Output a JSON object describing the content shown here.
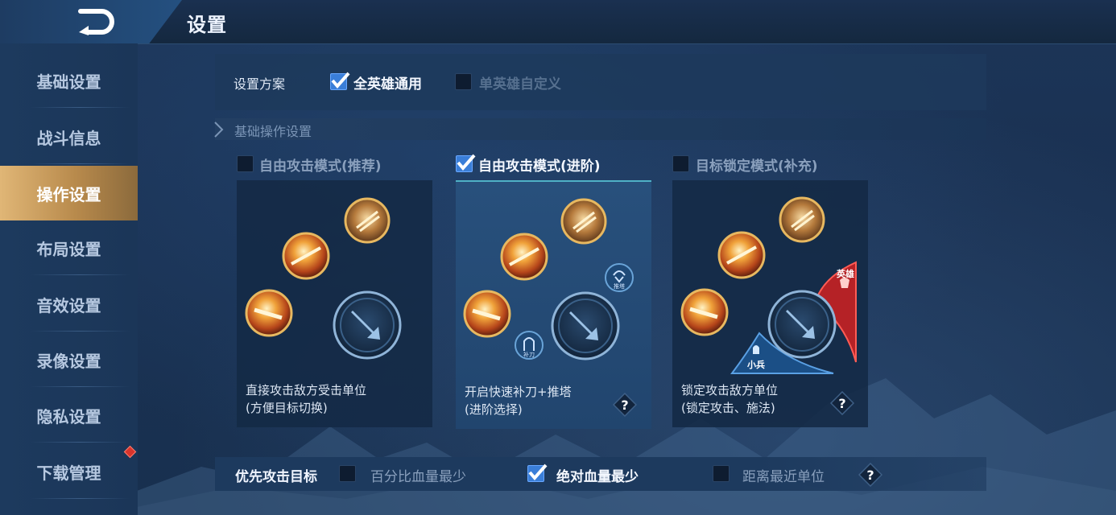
{
  "header": {
    "title": "设置"
  },
  "sidebar": {
    "items": [
      {
        "label": "基础设置"
      },
      {
        "label": "战斗信息"
      },
      {
        "label": "操作设置"
      },
      {
        "label": "布局设置"
      },
      {
        "label": "音效设置"
      },
      {
        "label": "录像设置"
      },
      {
        "label": "隐私设置"
      },
      {
        "label": "下载管理"
      }
    ],
    "active_index": 2
  },
  "scheme": {
    "label": "设置方案",
    "options": [
      {
        "label": "全英雄通用",
        "checked": true
      },
      {
        "label": "单英雄自定义",
        "checked": false
      }
    ]
  },
  "section": {
    "title": "基础操作设置"
  },
  "modes": [
    {
      "label": "自由攻击模式(推荐)",
      "checked": false,
      "desc1": "直接攻击敌方受击单位",
      "desc2": "(方便目标切换)",
      "has_help": false
    },
    {
      "label": "自由攻击模式(进阶)",
      "checked": true,
      "desc1": "开启快速补刀+推塔",
      "desc2": "(进阶选择)",
      "has_help": true,
      "badge_top": "推塔",
      "badge_bottom": "补刀"
    },
    {
      "label": "目标锁定模式(补充)",
      "checked": false,
      "desc1": "锁定攻击敌方单位",
      "desc2": "(锁定攻击、施法)",
      "has_help": true,
      "hero_tab": "英雄",
      "minion_tab": "小兵"
    }
  ],
  "priority": {
    "label": "优先攻击目标",
    "options": [
      {
        "label": "百分比血量最少",
        "checked": false
      },
      {
        "label": "绝对血量最少",
        "checked": true
      },
      {
        "label": "距离最近单位",
        "checked": false
      }
    ]
  },
  "help_glyph": "?",
  "colors": {
    "accent_gold": "#d9ae6e",
    "check_blue": "#3a7ed8",
    "card_selected": "#24497a",
    "teal_line": "#4fb1c6",
    "hero_red": "#c0282a"
  }
}
